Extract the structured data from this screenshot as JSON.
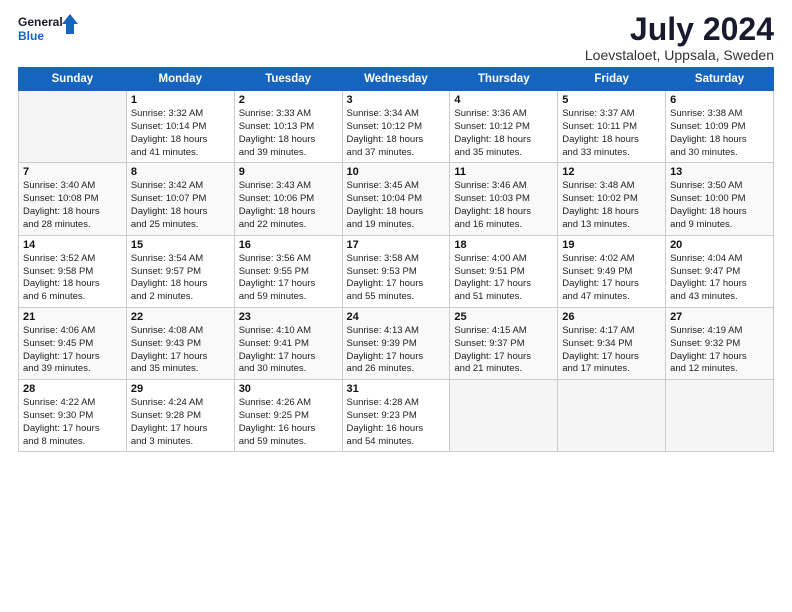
{
  "logo": {
    "line1": "General",
    "line2": "Blue"
  },
  "title": {
    "month_year": "July 2024",
    "location": "Loevstaloet, Uppsala, Sweden"
  },
  "weekdays": [
    "Sunday",
    "Monday",
    "Tuesday",
    "Wednesday",
    "Thursday",
    "Friday",
    "Saturday"
  ],
  "weeks": [
    [
      {
        "day": "",
        "info": ""
      },
      {
        "day": "1",
        "info": "Sunrise: 3:32 AM\nSunset: 10:14 PM\nDaylight: 18 hours\nand 41 minutes."
      },
      {
        "day": "2",
        "info": "Sunrise: 3:33 AM\nSunset: 10:13 PM\nDaylight: 18 hours\nand 39 minutes."
      },
      {
        "day": "3",
        "info": "Sunrise: 3:34 AM\nSunset: 10:12 PM\nDaylight: 18 hours\nand 37 minutes."
      },
      {
        "day": "4",
        "info": "Sunrise: 3:36 AM\nSunset: 10:12 PM\nDaylight: 18 hours\nand 35 minutes."
      },
      {
        "day": "5",
        "info": "Sunrise: 3:37 AM\nSunset: 10:11 PM\nDaylight: 18 hours\nand 33 minutes."
      },
      {
        "day": "6",
        "info": "Sunrise: 3:38 AM\nSunset: 10:09 PM\nDaylight: 18 hours\nand 30 minutes."
      }
    ],
    [
      {
        "day": "7",
        "info": "Sunrise: 3:40 AM\nSunset: 10:08 PM\nDaylight: 18 hours\nand 28 minutes."
      },
      {
        "day": "8",
        "info": "Sunrise: 3:42 AM\nSunset: 10:07 PM\nDaylight: 18 hours\nand 25 minutes."
      },
      {
        "day": "9",
        "info": "Sunrise: 3:43 AM\nSunset: 10:06 PM\nDaylight: 18 hours\nand 22 minutes."
      },
      {
        "day": "10",
        "info": "Sunrise: 3:45 AM\nSunset: 10:04 PM\nDaylight: 18 hours\nand 19 minutes."
      },
      {
        "day": "11",
        "info": "Sunrise: 3:46 AM\nSunset: 10:03 PM\nDaylight: 18 hours\nand 16 minutes."
      },
      {
        "day": "12",
        "info": "Sunrise: 3:48 AM\nSunset: 10:02 PM\nDaylight: 18 hours\nand 13 minutes."
      },
      {
        "day": "13",
        "info": "Sunrise: 3:50 AM\nSunset: 10:00 PM\nDaylight: 18 hours\nand 9 minutes."
      }
    ],
    [
      {
        "day": "14",
        "info": "Sunrise: 3:52 AM\nSunset: 9:58 PM\nDaylight: 18 hours\nand 6 minutes."
      },
      {
        "day": "15",
        "info": "Sunrise: 3:54 AM\nSunset: 9:57 PM\nDaylight: 18 hours\nand 2 minutes."
      },
      {
        "day": "16",
        "info": "Sunrise: 3:56 AM\nSunset: 9:55 PM\nDaylight: 17 hours\nand 59 minutes."
      },
      {
        "day": "17",
        "info": "Sunrise: 3:58 AM\nSunset: 9:53 PM\nDaylight: 17 hours\nand 55 minutes."
      },
      {
        "day": "18",
        "info": "Sunrise: 4:00 AM\nSunset: 9:51 PM\nDaylight: 17 hours\nand 51 minutes."
      },
      {
        "day": "19",
        "info": "Sunrise: 4:02 AM\nSunset: 9:49 PM\nDaylight: 17 hours\nand 47 minutes."
      },
      {
        "day": "20",
        "info": "Sunrise: 4:04 AM\nSunset: 9:47 PM\nDaylight: 17 hours\nand 43 minutes."
      }
    ],
    [
      {
        "day": "21",
        "info": "Sunrise: 4:06 AM\nSunset: 9:45 PM\nDaylight: 17 hours\nand 39 minutes."
      },
      {
        "day": "22",
        "info": "Sunrise: 4:08 AM\nSunset: 9:43 PM\nDaylight: 17 hours\nand 35 minutes."
      },
      {
        "day": "23",
        "info": "Sunrise: 4:10 AM\nSunset: 9:41 PM\nDaylight: 17 hours\nand 30 minutes."
      },
      {
        "day": "24",
        "info": "Sunrise: 4:13 AM\nSunset: 9:39 PM\nDaylight: 17 hours\nand 26 minutes."
      },
      {
        "day": "25",
        "info": "Sunrise: 4:15 AM\nSunset: 9:37 PM\nDaylight: 17 hours\nand 21 minutes."
      },
      {
        "day": "26",
        "info": "Sunrise: 4:17 AM\nSunset: 9:34 PM\nDaylight: 17 hours\nand 17 minutes."
      },
      {
        "day": "27",
        "info": "Sunrise: 4:19 AM\nSunset: 9:32 PM\nDaylight: 17 hours\nand 12 minutes."
      }
    ],
    [
      {
        "day": "28",
        "info": "Sunrise: 4:22 AM\nSunset: 9:30 PM\nDaylight: 17 hours\nand 8 minutes."
      },
      {
        "day": "29",
        "info": "Sunrise: 4:24 AM\nSunset: 9:28 PM\nDaylight: 17 hours\nand 3 minutes."
      },
      {
        "day": "30",
        "info": "Sunrise: 4:26 AM\nSunset: 9:25 PM\nDaylight: 16 hours\nand 59 minutes."
      },
      {
        "day": "31",
        "info": "Sunrise: 4:28 AM\nSunset: 9:23 PM\nDaylight: 16 hours\nand 54 minutes."
      },
      {
        "day": "",
        "info": ""
      },
      {
        "day": "",
        "info": ""
      },
      {
        "day": "",
        "info": ""
      }
    ]
  ]
}
